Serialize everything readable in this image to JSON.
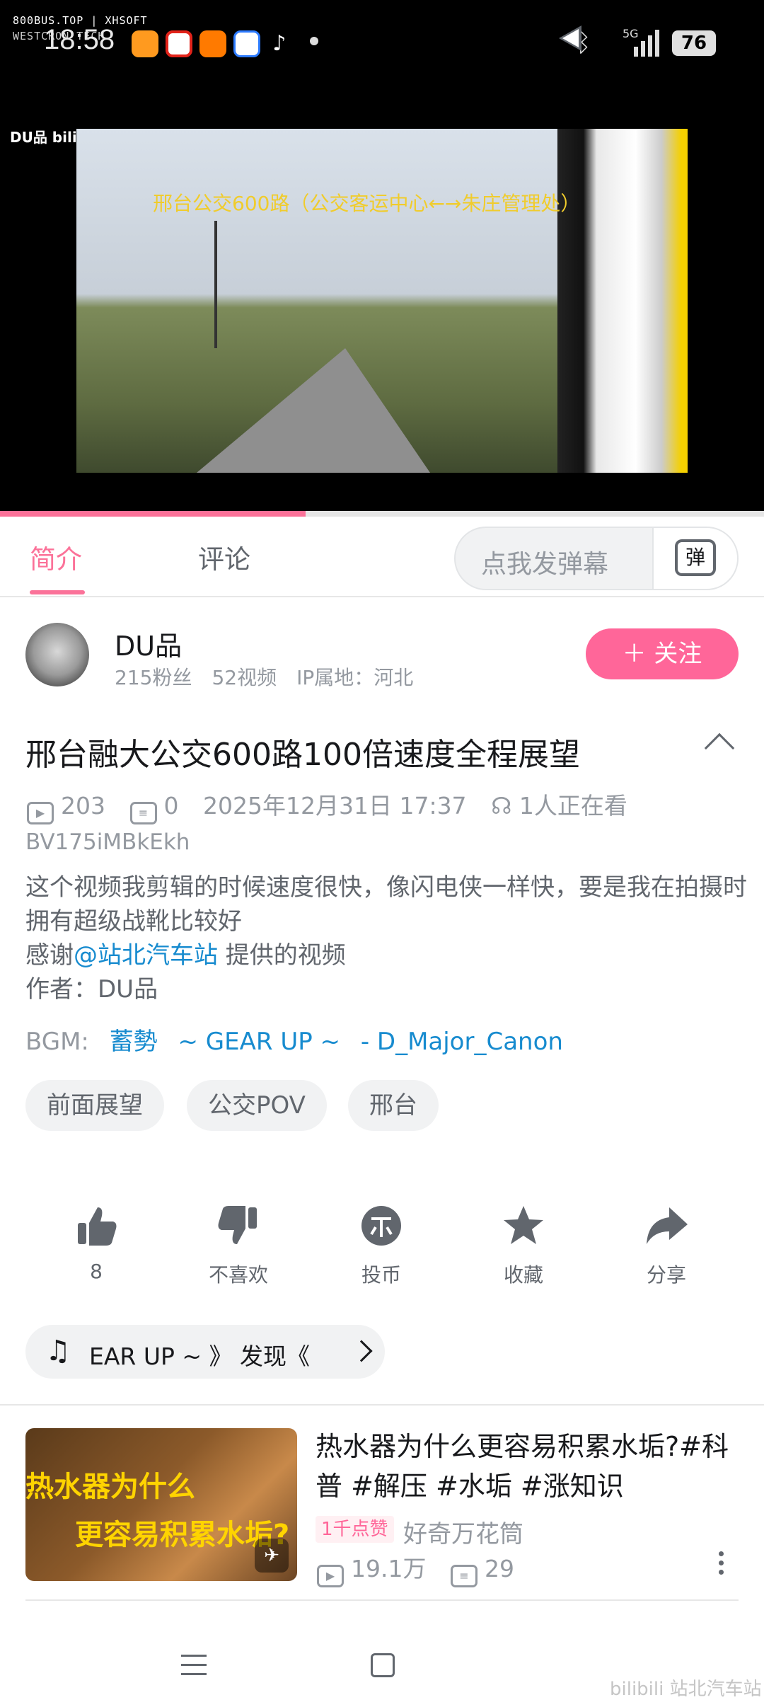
{
  "status_bar": {
    "watermark_line1": "800BUS.TOP | XHSOFT",
    "watermark_line2": "WESTCRON TECH",
    "time": "18:58",
    "network": "5G",
    "battery": "76"
  },
  "video": {
    "caption": "邢台公交600路（公交客运中心←→朱庄管理处）",
    "logo": "DU品 bilibili",
    "progress_fraction": 0.4
  },
  "tabs": {
    "intro": "简介",
    "comments": "评论",
    "danmaku_placeholder": "点我发弹幕",
    "danmaku_button": "弹"
  },
  "author": {
    "name": "DU品",
    "fans": "215粉丝",
    "videos": "52视频",
    "ip": "IP属地：河北",
    "follow_label": "＋ 关注"
  },
  "video_info": {
    "title": "邢台融大公交600路100倍速度全程展望",
    "plays": "203",
    "danmaku_count": "0",
    "date": "2025年12月31日 17:37",
    "watching": "1人正在看",
    "bvid": "BV175iMBkEkh",
    "desc_line1": "这个视频我剪辑的时候速度很快，像闪电侠一样快，要是我在拍摄时拥有超级战靴比较好",
    "desc_thanks_prefix": "感谢",
    "desc_mention": "@站北汽车站",
    "desc_thanks_suffix": " 提供的视频",
    "desc_author": "作者：DU品",
    "bgm_label": "BGM:",
    "bgm_tracks": [
      "蓄勢",
      "~ GEAR UP ~",
      "- D_Major_Canon"
    ],
    "tags": [
      "前面展望",
      "公交POV",
      "邢台"
    ]
  },
  "actions": {
    "like": "8",
    "dislike": "不喜欢",
    "coin": "投币",
    "favorite": "收藏",
    "share": "分享"
  },
  "music": {
    "text": "EAR UP ~ 》   发现《"
  },
  "related": {
    "thumb_line1": "热水器为什么",
    "thumb_line2": "更容易积累水垢?",
    "title": "热水器为什么更容易积累水垢?#科普 #解压 #水垢 #涨知识",
    "badge": "1千点赞",
    "uploader": "好奇万花筒",
    "plays": "19.1万",
    "danmaku": "29"
  },
  "bottom_watermark": "bilibili 站北汽车站",
  "colors": {
    "accent": "#fb7299",
    "follow": "#ff6699",
    "link": "#178bcf"
  }
}
